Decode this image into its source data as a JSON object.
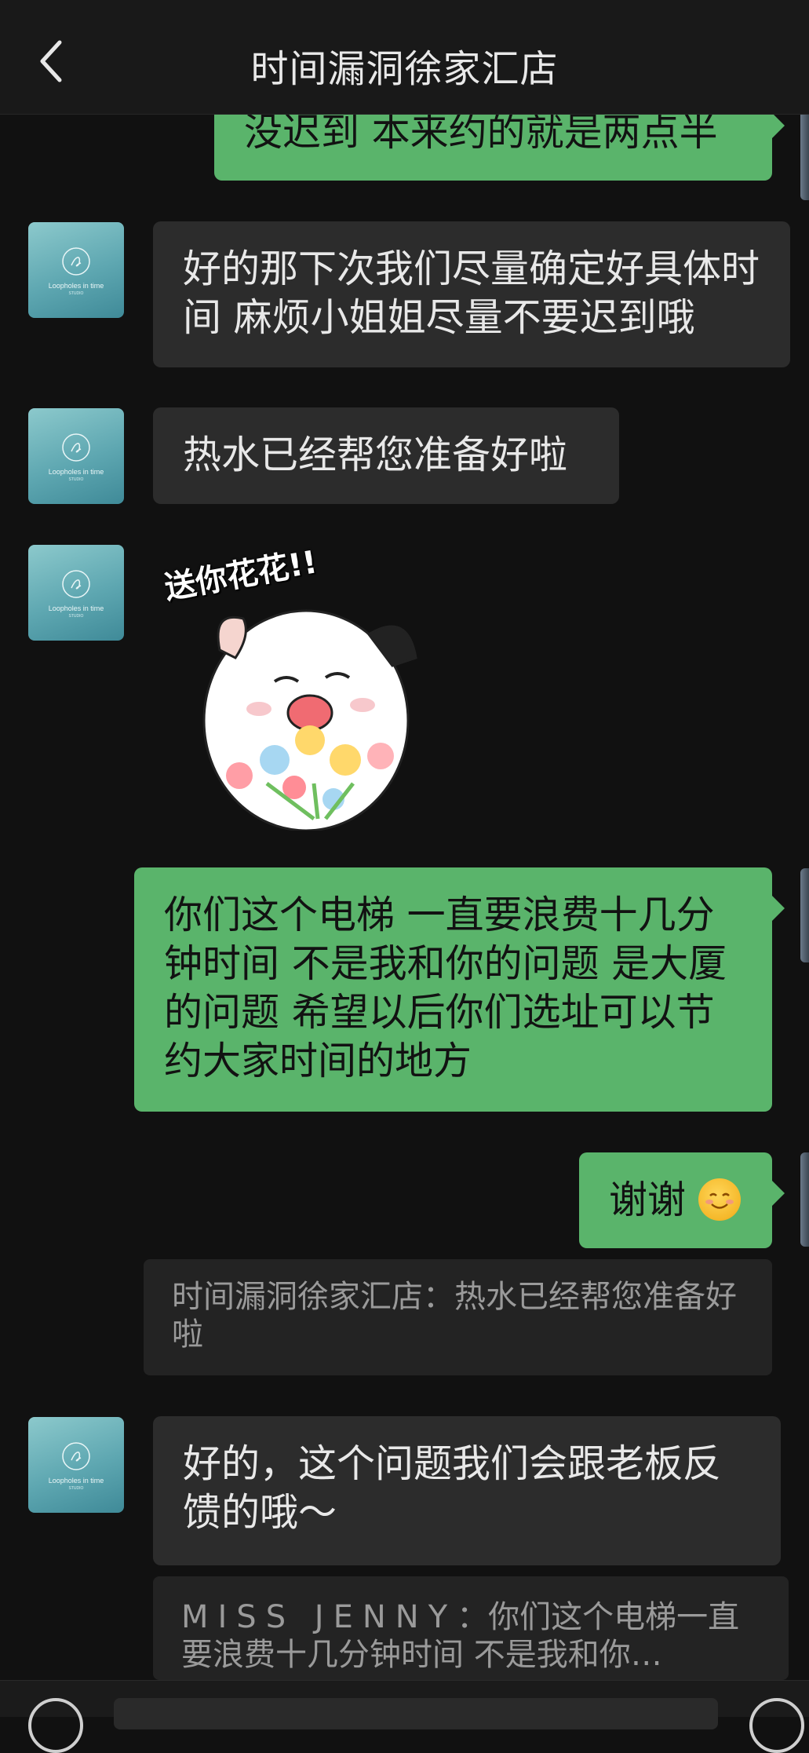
{
  "header": {
    "title": "时间漏洞徐家汇店",
    "back_icon": "chevron-left-icon"
  },
  "avatar": {
    "brand": "Loopholes in time",
    "sub": "STUDIO"
  },
  "messages": {
    "m1": "没迟到 本来约的就是两点半",
    "m2": "好的那下次我们尽量确定好具体时间 麻烦小姐姐尽量不要迟到哦",
    "m3": "热水已经帮您准备好啦",
    "m4_sticker_text": "送你花花!!",
    "m5": "你们这个电梯 一直要浪费十几分钟时间 不是我和你的问题 是大厦的问题 希望以后你们选址可以节约大家时间的地方",
    "m6": "谢谢",
    "m6_emoji": "relieved-smile-emoji",
    "m7": "好的，这个问题我们会跟老板反馈的哦～"
  },
  "quotes": {
    "q1": "时间漏洞徐家汇店：热水已经帮您准备好啦",
    "q2_name": "MISS JENNY",
    "q2_text": "：你们这个电梯一直要浪费十几分钟时间 不是我和你…"
  },
  "colors": {
    "background": "#111111",
    "incoming_bubble": "#2c2c2c",
    "outgoing_bubble": "#5ab46b"
  }
}
